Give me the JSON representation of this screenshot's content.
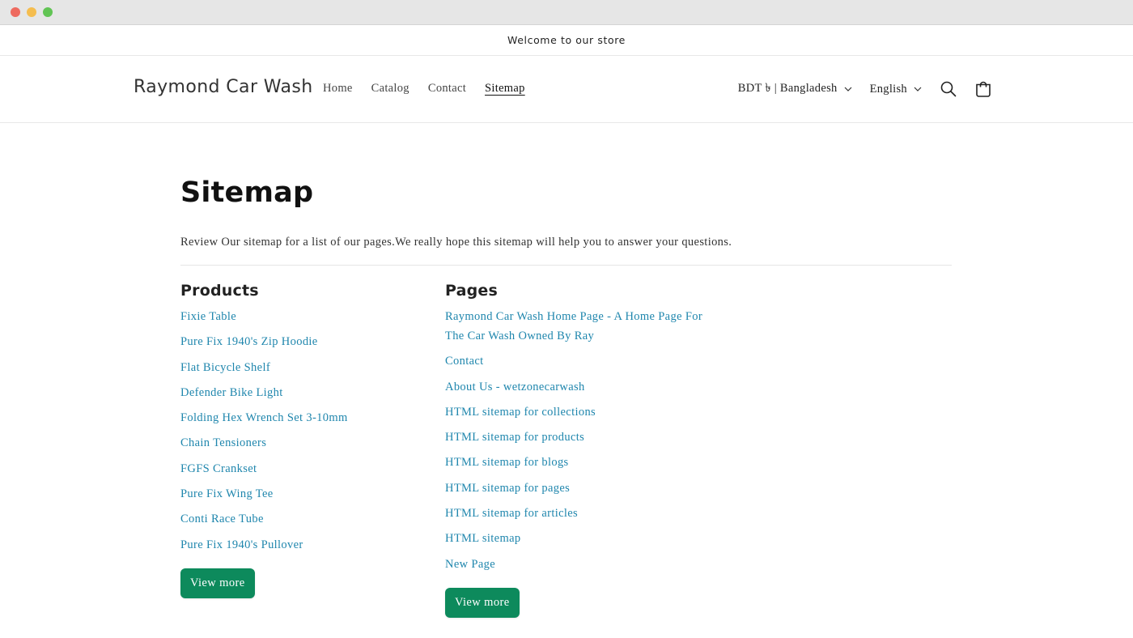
{
  "announcement": "Welcome to our store",
  "header": {
    "brand": "Raymond Car Wash",
    "nav": [
      {
        "label": "Home"
      },
      {
        "label": "Catalog"
      },
      {
        "label": "Contact"
      },
      {
        "label": "Sitemap",
        "active": true
      }
    ],
    "country": "BDT ৳ | Bangladesh",
    "language": "English",
    "icons": [
      "search-icon",
      "cart-icon",
      "chevron-down-icon"
    ]
  },
  "main": {
    "title": "Sitemap",
    "intro": "Review Our sitemap for a list of our pages.We really hope this sitemap will help you to answer your questions.",
    "products": {
      "heading": "Products",
      "items": [
        "Fixie Table",
        "Pure Fix 1940's Zip Hoodie",
        "Flat Bicycle Shelf",
        "Defender Bike Light",
        "Folding Hex Wrench Set 3-10mm",
        "Chain Tensioners",
        "FGFS Crankset",
        "Pure Fix Wing Tee",
        "Conti Race Tube",
        "Pure Fix 1940's Pullover"
      ],
      "button": "View more"
    },
    "pages": {
      "heading": "Pages",
      "items": [
        "Raymond Car Wash Home Page - A Home Page For The Car Wash Owned By Ray",
        "Contact",
        "About Us - wetzonecarwash",
        "HTML sitemap for collections",
        "HTML sitemap for products",
        "HTML sitemap for blogs",
        "HTML sitemap for pages",
        "HTML sitemap for articles",
        "HTML sitemap",
        "New Page"
      ],
      "button": "View more"
    }
  },
  "colors": {
    "link": "#1f86ad",
    "button": "#0d8a5c"
  }
}
